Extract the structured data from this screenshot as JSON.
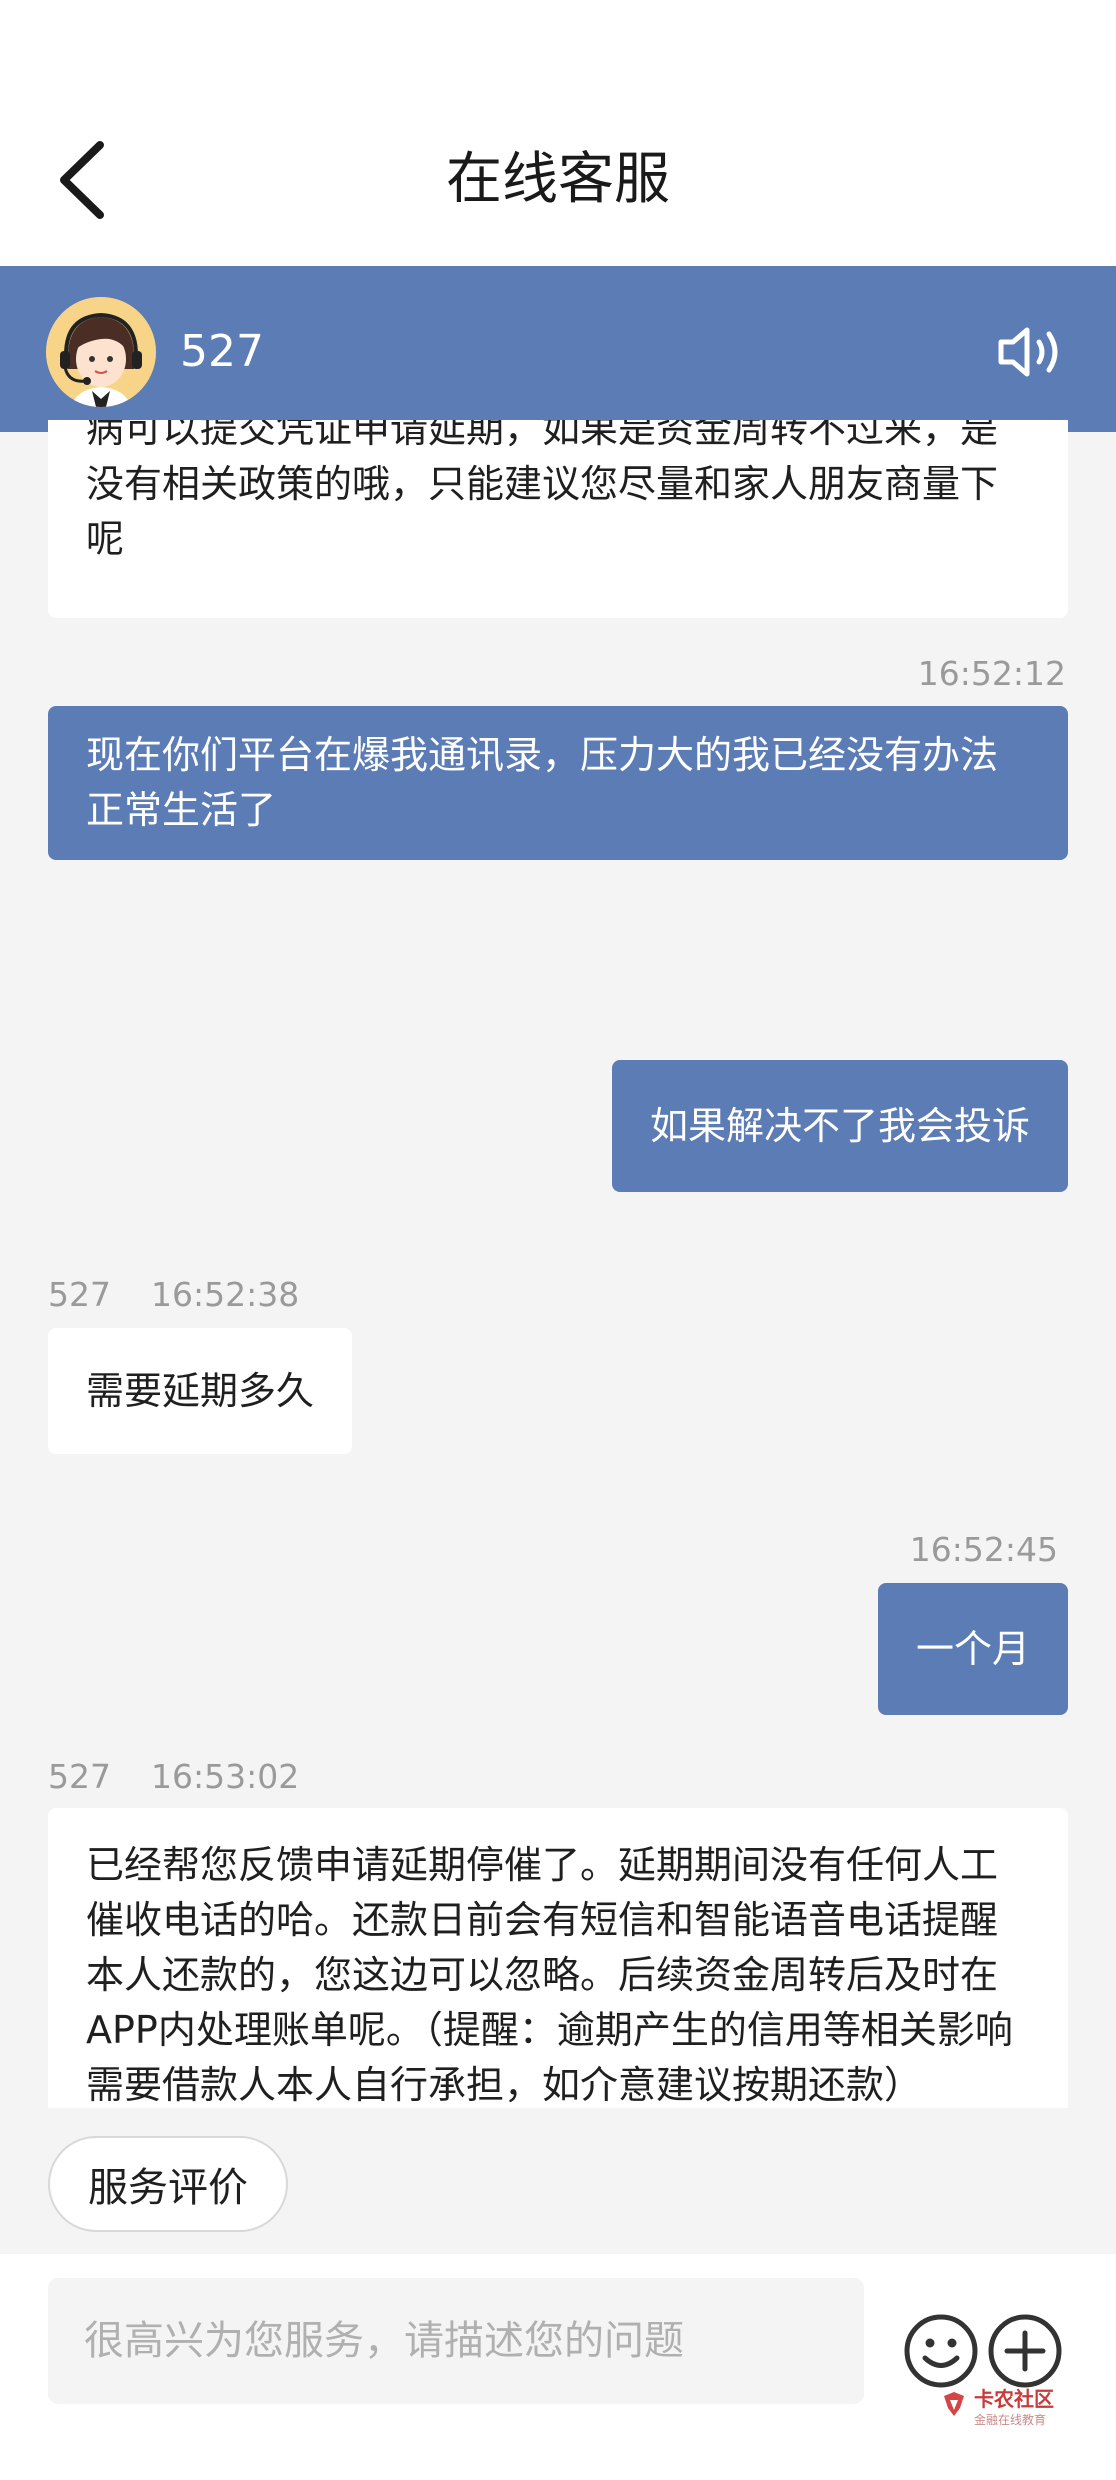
{
  "header": {
    "title": "在线客服",
    "back_icon": "chevron-left-icon"
  },
  "agent": {
    "name": "527",
    "avatar_icon": "customer-service-avatar-icon",
    "speaker_icon": "speaker-icon",
    "bar_color": "#5c7cb6"
  },
  "messages": [
    {
      "side": "left",
      "text": "病可以提交凭证申请延期，如果是资金周转不过来，是没有相关政策的哦，只能建议您尽量和家人朋友商量下呢"
    },
    {
      "side": "right",
      "time": "16:52:12",
      "text": "现在你们平台在爆我通讯录，压力大的我已经没有办法正常生活了"
    },
    {
      "side": "right",
      "text": "如果解决不了我会投诉"
    },
    {
      "side": "left",
      "sender": "527",
      "time": "16:52:38",
      "text": "需要延期多久"
    },
    {
      "side": "right",
      "time": "16:52:45",
      "text": "一个月"
    },
    {
      "side": "left",
      "sender": "527",
      "time": "16:53:02",
      "text": "已经帮您反馈申请延期停催了。延期期间没有任何人工催收电话的哈。还款日前会有短信和智能语音电话提醒本人还款的，您这边可以忽略。后续资金周转后及时在APP内处理账单呢。（提醒：逾期产生的信用等相关影响需要借款人本人自行承担，如介意建议按期还款）"
    }
  ],
  "footer": {
    "rate_button": "服务评价",
    "input_placeholder": "很高兴为您服务，请描述您的问题",
    "emoji_icon": "smiley-icon",
    "plus_icon": "plus-circle-icon"
  },
  "watermark": {
    "text": "卡农社区",
    "sub": "金融在线教育"
  },
  "colors": {
    "accent": "#5c7cb6",
    "background": "#f4f4f4"
  }
}
